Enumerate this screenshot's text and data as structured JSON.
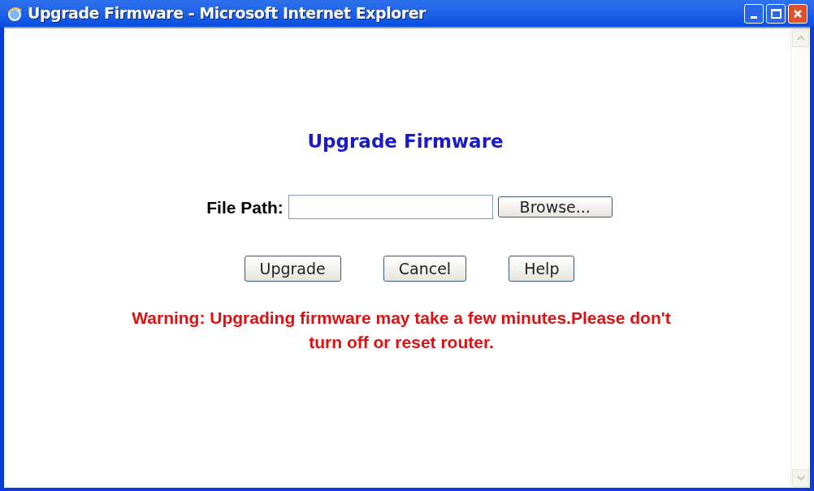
{
  "window": {
    "title": "Upgrade Firmware - Microsoft Internet Explorer"
  },
  "heading": "Upgrade Firmware",
  "file_path": {
    "label": "File Path:",
    "browse": "Browse..."
  },
  "buttons": [
    "Upgrade",
    "Cancel",
    "Help"
  ],
  "warning": [
    "Warning: Upgrading firmware may take a few minutes.Please don't",
    "turn off or reset router."
  ]
}
